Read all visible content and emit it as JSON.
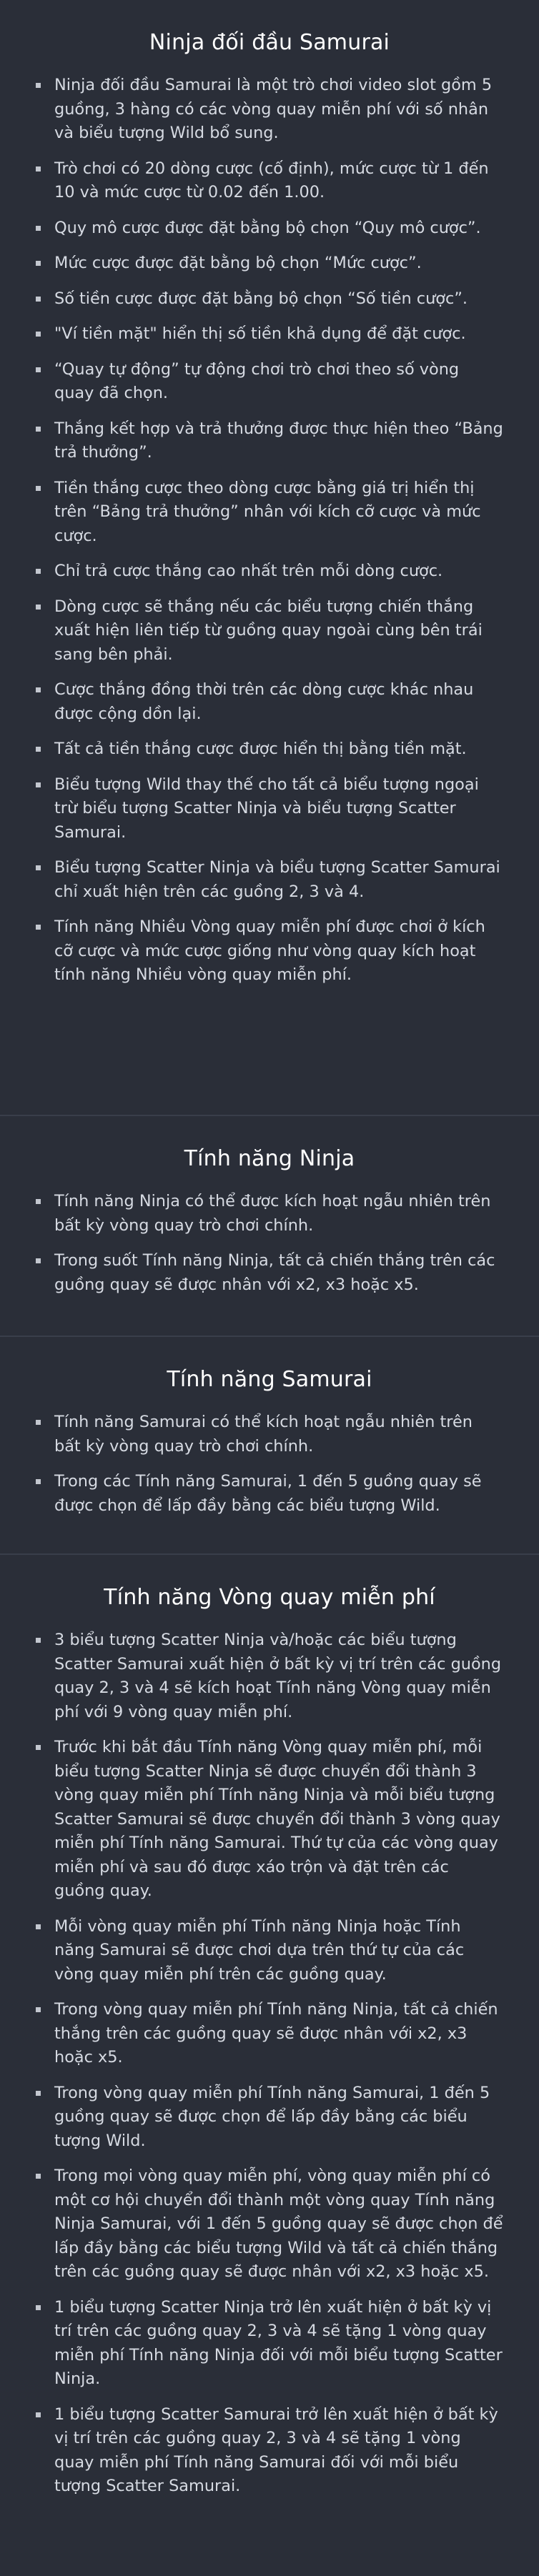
{
  "sections": [
    {
      "title": "Ninja đối đầu Samurai",
      "items": [
        "Ninja đối đầu Samurai là một trò chơi video slot gồm 5 guồng, 3 hàng có các vòng quay miễn phí với số nhân và biểu tượng Wild bổ sung.",
        "Trò chơi có 20 dòng cược (cố định), mức cược từ 1 đến 10 và mức cược từ 0.02 đến 1.00.",
        "Quy mô cược được đặt bằng bộ chọn “Quy mô cược”.",
        "Mức cược được đặt bằng bộ chọn “Mức cược”.",
        "Số tiền cược được đặt bằng bộ chọn “Số tiền cược”.",
        "\"Ví tiền mặt\" hiển thị số tiền khả dụng để đặt cược.",
        "“Quay tự động” tự động chơi trò chơi theo số vòng quay đã chọn.",
        "Thắng kết hợp và trả thưởng được thực hiện theo “Bảng trả thưởng”.",
        "Tiền thắng cược theo dòng cược bằng giá trị hiển thị trên “Bảng trả thưởng” nhân với kích cỡ cược và mức cược.",
        "Chỉ trả cược thắng cao nhất trên mỗi dòng cược.",
        "Dòng cược sẽ thắng nếu các biểu tượng chiến thắng xuất hiện liên tiếp từ guồng quay ngoài cùng bên trái sang bên phải.",
        "Cược thắng đồng thời trên các dòng cược khác nhau được cộng dồn lại.",
        "Tất cả tiền thắng cược được hiển thị bằng tiền mặt.",
        "Biểu tượng Wild thay thế cho tất cả biểu tượng ngoại trừ biểu tượng Scatter Ninja và biểu tượng Scatter Samurai.",
        "Biểu tượng Scatter Ninja và biểu tượng Scatter Samurai chỉ xuất hiện trên các guồng 2, 3 và 4.",
        "Tính năng Nhiều Vòng quay miễn phí được chơi ở kích cỡ cược và mức cược giống như vòng quay kích hoạt tính năng Nhiều vòng quay miễn phí."
      ]
    },
    {
      "title": "Tính năng Ninja",
      "items": [
        "Tính năng Ninja có thể được kích hoạt ngẫu nhiên trên bất kỳ vòng quay trò chơi chính.",
        "Trong suốt Tính năng Ninja, tất cả chiến thắng trên các guồng quay sẽ được nhân với x2, x3 hoặc x5."
      ]
    },
    {
      "title": "Tính năng Samurai",
      "items": [
        "Tính năng Samurai có thể kích hoạt ngẫu nhiên trên bất kỳ vòng quay trò chơi chính.",
        "Trong các Tính năng Samurai, 1 đến 5 guồng quay sẽ được chọn để lấp đầy bằng các biểu tượng Wild."
      ]
    },
    {
      "title": "Tính năng Vòng quay miễn phí",
      "items": [
        "3 biểu tượng Scatter Ninja và/hoặc các biểu tượng Scatter Samurai xuất hiện ở bất kỳ vị trí trên các guồng quay 2, 3 và 4 sẽ kích hoạt Tính năng Vòng quay miễn phí với 9 vòng quay miễn phí.",
        "Trước khi bắt đầu Tính năng Vòng quay miễn phí, mỗi biểu tượng Scatter Ninja sẽ được chuyển đổi thành 3 vòng quay miễn phí Tính năng Ninja và mỗi biểu tượng Scatter Samurai sẽ được chuyển đổi thành 3 vòng quay miễn phí Tính năng Samurai. Thứ tự của các vòng quay miễn phí và sau đó được xáo trộn và đặt trên các guồng quay.",
        "Mỗi vòng quay miễn phí Tính năng Ninja hoặc Tính năng Samurai sẽ được chơi dựa trên thứ tự của các vòng quay miễn phí trên các guồng quay.",
        "Trong vòng quay miễn phí Tính năng Ninja, tất cả chiến thắng trên các guồng quay sẽ được nhân với x2, x3 hoặc x5.",
        "Trong vòng quay miễn phí Tính năng Samurai, 1 đến 5 guồng quay sẽ được chọn để lấp đầy bằng các biểu tượng Wild.",
        "Trong mọi vòng quay miễn phí, vòng quay miễn phí có một cơ hội chuyển đổi thành một vòng quay Tính năng Ninja Samurai, với 1 đến 5 guồng quay sẽ được chọn để lấp đầy bằng các biểu tượng Wild và tất cả chiến thắng trên các guồng quay sẽ được nhân với x2, x3 hoặc x5.",
        "1 biểu tượng Scatter Ninja trở lên xuất hiện ở bất kỳ vị trí trên các guồng quay 2, 3 và 4 sẽ tặng 1 vòng quay miễn phí Tính năng Ninja đối với mỗi biểu tượng Scatter Ninja.",
        "1 biểu tượng Scatter Samurai trở lên xuất hiện ở bất kỳ vị trí trên các guồng quay 2, 3 và 4 sẽ tặng 1 vòng quay miễn phí Tính năng Samurai đối với mỗi biểu tượng Scatter Samurai."
      ]
    }
  ]
}
